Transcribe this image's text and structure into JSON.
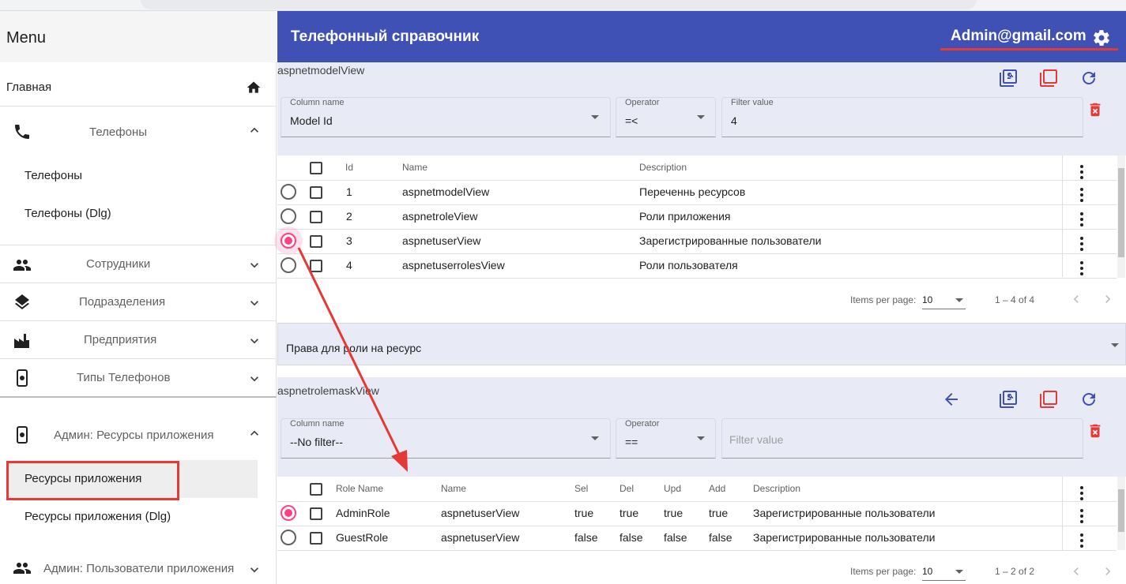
{
  "sidebar": {
    "menu_title": "Menu",
    "home_label": "Главная",
    "groups": [
      {
        "label": "Телефоны",
        "icon": "phone-icon",
        "expanded": true,
        "items": [
          {
            "label": "Телефоны"
          },
          {
            "label": "Телефоны (Dlg)"
          }
        ]
      },
      {
        "label": "Сотрудники",
        "icon": "people-icon",
        "expanded": false
      },
      {
        "label": "Подразделения",
        "icon": "layers-icon",
        "expanded": false
      },
      {
        "label": "Предприятия",
        "icon": "factory-icon",
        "expanded": false
      },
      {
        "label": "Типы Телефонов",
        "icon": "phone-settings-icon",
        "expanded": false
      },
      {
        "label": "Админ: Ресурсы приложения",
        "icon": "phone-settings-icon",
        "expanded": true,
        "items": [
          {
            "label": "Ресурсы приложения",
            "selected": true
          },
          {
            "label": "Ресурсы приложения (Dlg)"
          }
        ]
      },
      {
        "label": "Админ: Пользователи приложения",
        "icon": "people-icon",
        "expanded": false
      }
    ]
  },
  "header": {
    "title": "Телефонный справочник",
    "user": "Admin@gmail.com",
    "color": "#3f51b5"
  },
  "top_view": {
    "title": "aspnetmodelView",
    "filter": {
      "column_label": "Column name",
      "column_value": "Model Id",
      "operator_label": "Operator",
      "operator_value": "=<",
      "value_label": "Filter value",
      "value": "4"
    },
    "columns": [
      "Id",
      "Name",
      "Description"
    ],
    "rows": [
      {
        "id": "1",
        "name": "aspnetmodelView",
        "description": "Переченнь ресурсов",
        "selected": false
      },
      {
        "id": "2",
        "name": "aspnetroleView",
        "description": "Роли приложения",
        "selected": false
      },
      {
        "id": "3",
        "name": "aspnetuserView",
        "description": "Зарегистрированные пользователи",
        "selected": true
      },
      {
        "id": "4",
        "name": "aspnetuserrolesView",
        "description": "Роли пользователя",
        "selected": false
      }
    ],
    "paginator": {
      "items_label": "Items per page:",
      "page_size": "10",
      "range": "1 – 4 of 4"
    }
  },
  "detail_select": {
    "value": "Права для роли на ресурс"
  },
  "bottom_view": {
    "title": "aspnetrolemaskView",
    "filter": {
      "column_label": "Column name",
      "column_value": "--No filter--",
      "operator_label": "Operator",
      "operator_value": "==",
      "value_placeholder": "Filter value"
    },
    "columns": [
      "Role Name",
      "Name",
      "Sel",
      "Del",
      "Upd",
      "Add",
      "Description"
    ],
    "rows": [
      {
        "role": "AdminRole",
        "name": "aspnetuserView",
        "sel": "true",
        "del": "true",
        "upd": "true",
        "add": "true",
        "description": "Зарегистрированные пользователи",
        "selected": true
      },
      {
        "role": "GuestRole",
        "name": "aspnetuserView",
        "sel": "false",
        "del": "false",
        "upd": "false",
        "add": "false",
        "description": "Зарегистрированные пользователи",
        "selected": false
      }
    ],
    "paginator": {
      "items_label": "Items per page:",
      "page_size": "10",
      "range": "1 – 2 of 2"
    }
  },
  "colors": {
    "primary": "#3f51b5",
    "accent": "#ff4081",
    "warn": "#e53935",
    "panel": "#e8eaf6"
  }
}
